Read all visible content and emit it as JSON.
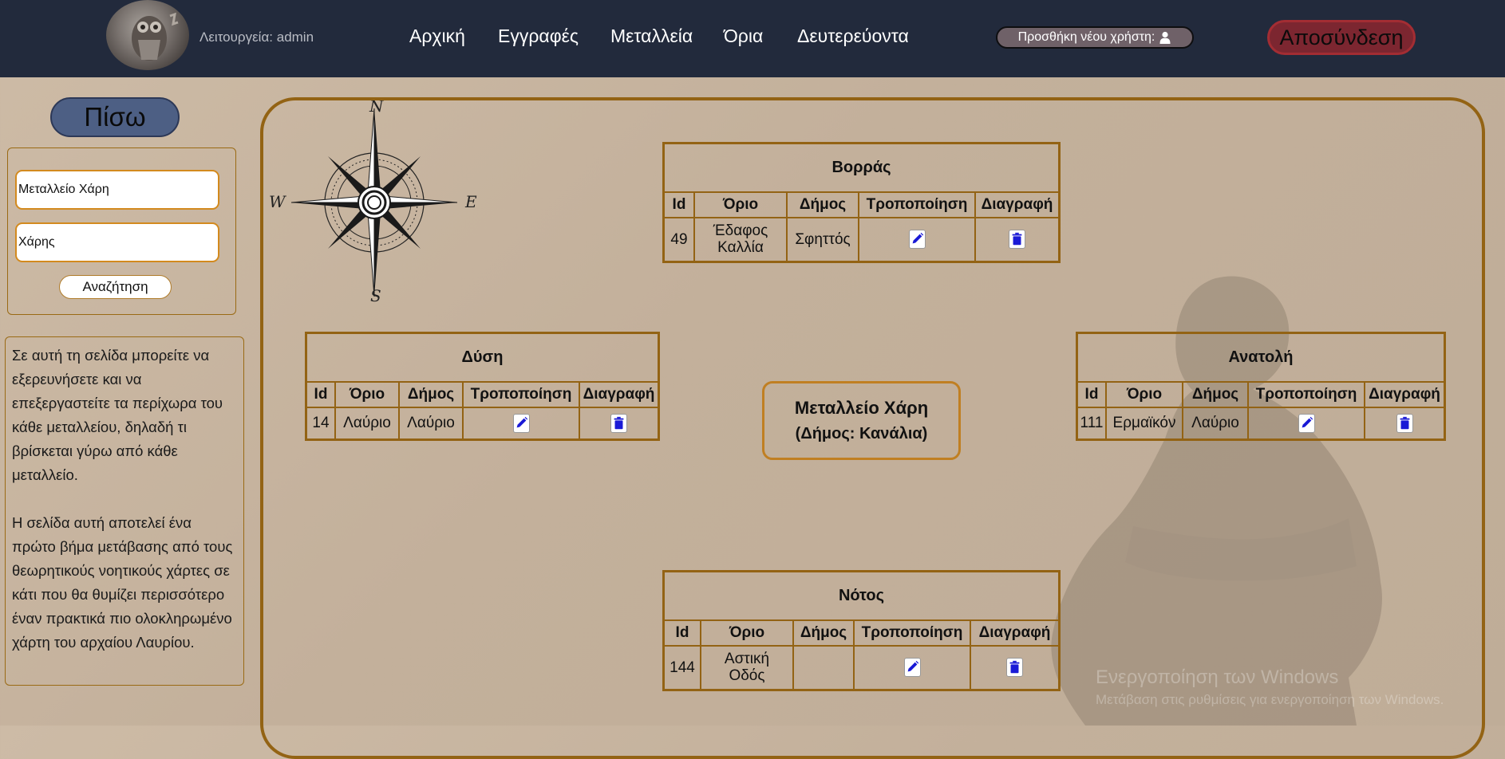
{
  "header": {
    "mode_label": "Λειτουργεία: admin",
    "nav": [
      "Αρχική",
      "Εγγραφές",
      "Μεταλλεία",
      "Όρια",
      "Δευτερεύοντα"
    ],
    "add_user_label": "Προσθήκη νέου χρήστη:",
    "logout_label": "Αποσύνδεση"
  },
  "sidebar": {
    "back_label": "Πίσω",
    "search_mine_value": "Μεταλλείο Χάρη",
    "search_owner_value": "Χάρης",
    "search_button": "Αναζήτηση",
    "info_paragraph_1": "Σε αυτή τη σελίδα μπορείτε να εξερευνήσετε και να επεξεργαστείτε τα περίχωρα του κάθε μεταλλείου, δηλαδή τι βρίσκεται γύρω από κάθε μεταλλείο.",
    "info_paragraph_2": "Η σελίδα αυτή αποτελεί ένα πρώτο βήμα μετάβασης από τους θεωρητικούς νοητικούς χάρτες σε κάτι που θα θυμίζει περισσότερο έναν πρακτικά πιο ολοκληρωμένο χάρτη του αρχαίου Λαυρίου."
  },
  "compass": {
    "n": "N",
    "s": "S",
    "e": "E",
    "w": "W"
  },
  "columns": [
    "Id",
    "Όριο",
    "Δήμος",
    "Τροποποίηση",
    "Διαγραφή"
  ],
  "center": {
    "mine_name": "Μεταλλείο Χάρη",
    "municipality": "(Δήμος: Κανάλια)"
  },
  "tables": {
    "north": {
      "title": "Βορράς",
      "row": {
        "id": "49",
        "orio_1": "Έδαφος",
        "orio_2": "Καλλία",
        "dimos": "Σφηττός"
      }
    },
    "west": {
      "title": "Δύση",
      "row": {
        "id": "14",
        "orio": "Λαύριο",
        "dimos": "Λαύριο"
      }
    },
    "east": {
      "title": "Ανατολή",
      "row": {
        "id": "111",
        "orio": "Ερμαϊκόν",
        "dimos": "Λαύριο"
      }
    },
    "south": {
      "title": "Νότος",
      "row": {
        "id": "144",
        "orio_1": "Αστική",
        "orio_2": "Οδός",
        "dimos": ""
      }
    }
  },
  "watermark": {
    "line1": "Ενεργοποίηση των Windows",
    "line2": "Μετάβαση στις ρυθμίσεις για ενεργοποίηση των Windows."
  },
  "colors": {
    "topbar": "#222a3c",
    "border": "#936314",
    "logout": "#7c2630",
    "back": "#4d5f84",
    "icon": "#1a1ad6"
  }
}
